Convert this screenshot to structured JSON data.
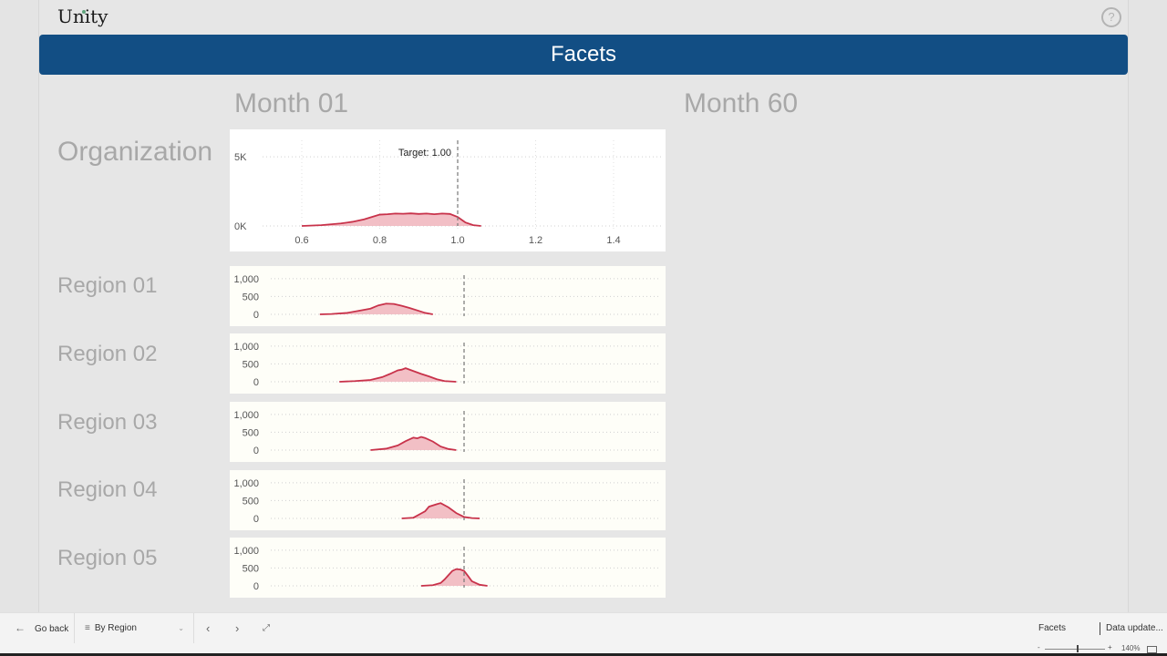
{
  "app": {
    "logo_text": "Unity",
    "help_icon": "question-circle-icon",
    "banner_title": "Facets"
  },
  "columns": [
    "Month 01",
    "Month 60"
  ],
  "rows": [
    "Organization",
    "Region 01",
    "Region 02",
    "Region 03",
    "Region 04",
    "Region 05"
  ],
  "colors": {
    "banner": "#124e84",
    "series_line": "#c8324a",
    "series_fill": "#f0b4bc",
    "target_line": "#777777"
  },
  "chart_data": [
    {
      "type": "area",
      "title": "Organization — Month 01",
      "xlabel": "",
      "ylabel": "",
      "xlim": [
        0.5,
        1.52
      ],
      "ylim": [
        0,
        5800
      ],
      "x_ticks": [
        0.6,
        0.8,
        1.0,
        1.2,
        1.4
      ],
      "x_tick_labels": [
        "0.6",
        "0.8",
        "1.0",
        "1.2",
        "1.4"
      ],
      "y_ticks": [
        0,
        5000
      ],
      "y_tick_labels": [
        "0K",
        "5K"
      ],
      "grid": true,
      "target": {
        "value": 1.0,
        "label": "Target: 1.00"
      },
      "x": [
        0.6,
        0.65,
        0.7,
        0.73,
        0.76,
        0.78,
        0.8,
        0.82,
        0.84,
        0.86,
        0.88,
        0.9,
        0.92,
        0.94,
        0.96,
        0.98,
        1.0,
        1.02,
        1.04,
        1.06
      ],
      "values": [
        0,
        60,
        180,
        300,
        480,
        650,
        820,
        850,
        900,
        880,
        910,
        870,
        900,
        850,
        900,
        870,
        650,
        250,
        60,
        0
      ]
    },
    {
      "type": "area",
      "title": "Region 01 — Month 01",
      "xlim": [
        0.5,
        1.52
      ],
      "ylim": [
        0,
        1150
      ],
      "y_ticks": [
        0,
        500,
        1000
      ],
      "y_tick_labels": [
        "0",
        "500",
        "1,000"
      ],
      "grid": true,
      "target": {
        "value": 1.0
      },
      "x": [
        0.63,
        0.66,
        0.7,
        0.73,
        0.76,
        0.78,
        0.8,
        0.82,
        0.84,
        0.86,
        0.88,
        0.9,
        0.92
      ],
      "values": [
        0,
        10,
        40,
        100,
        160,
        250,
        300,
        290,
        240,
        180,
        110,
        40,
        0
      ]
    },
    {
      "type": "area",
      "title": "Region 02 — Month 01",
      "xlim": [
        0.5,
        1.52
      ],
      "ylim": [
        0,
        1150
      ],
      "y_ticks": [
        0,
        500,
        1000
      ],
      "y_tick_labels": [
        "0",
        "500",
        "1,000"
      ],
      "grid": true,
      "target": {
        "value": 1.0
      },
      "x": [
        0.68,
        0.72,
        0.76,
        0.79,
        0.81,
        0.83,
        0.84,
        0.85,
        0.87,
        0.89,
        0.91,
        0.93,
        0.95,
        0.98
      ],
      "values": [
        0,
        20,
        50,
        130,
        220,
        320,
        340,
        380,
        300,
        220,
        150,
        70,
        20,
        0
      ]
    },
    {
      "type": "area",
      "title": "Region 03 — Month 01",
      "xlim": [
        0.5,
        1.52
      ],
      "ylim": [
        0,
        1150
      ],
      "y_ticks": [
        0,
        500,
        1000
      ],
      "y_tick_labels": [
        "0",
        "500",
        "1,000"
      ],
      "grid": true,
      "target": {
        "value": 1.0
      },
      "x": [
        0.76,
        0.8,
        0.83,
        0.85,
        0.87,
        0.88,
        0.89,
        0.9,
        0.92,
        0.94,
        0.96,
        0.98
      ],
      "values": [
        0,
        40,
        130,
        250,
        350,
        330,
        370,
        340,
        240,
        100,
        30,
        0
      ]
    },
    {
      "type": "area",
      "title": "Region 04 — Month 01",
      "xlim": [
        0.5,
        1.52
      ],
      "ylim": [
        0,
        1150
      ],
      "y_ticks": [
        0,
        500,
        1000
      ],
      "y_tick_labels": [
        "0",
        "500",
        "1,000"
      ],
      "grid": true,
      "target": {
        "value": 1.0
      },
      "x": [
        0.84,
        0.87,
        0.89,
        0.9,
        0.91,
        0.93,
        0.94,
        0.96,
        0.98,
        1.0,
        1.02,
        1.04
      ],
      "values": [
        0,
        20,
        140,
        200,
        330,
        400,
        430,
        310,
        150,
        40,
        10,
        0
      ]
    },
    {
      "type": "area",
      "title": "Region 05 — Month 01",
      "xlim": [
        0.5,
        1.52
      ],
      "ylim": [
        0,
        1150
      ],
      "y_ticks": [
        0,
        500,
        1000
      ],
      "y_tick_labels": [
        "0",
        "500",
        "1,000"
      ],
      "grid": true,
      "target": {
        "value": 1.0
      },
      "x": [
        0.89,
        0.92,
        0.94,
        0.95,
        0.96,
        0.97,
        0.98,
        0.99,
        1.0,
        1.01,
        1.02,
        1.04,
        1.06
      ],
      "values": [
        0,
        20,
        80,
        180,
        300,
        420,
        470,
        460,
        420,
        280,
        130,
        30,
        0
      ]
    }
  ],
  "bottom_bar": {
    "go_back_label": "Go back",
    "page_select_value": "By Region",
    "prev_icon": "chevron-left-icon",
    "next_icon": "chevron-right-icon",
    "collapse_icon": "collapse-icon",
    "page_name": "Facets",
    "data_update_label": "Data update..."
  },
  "status_bar": {
    "zoom_minus": "-",
    "zoom_plus": "+",
    "zoom_level": "140%"
  }
}
